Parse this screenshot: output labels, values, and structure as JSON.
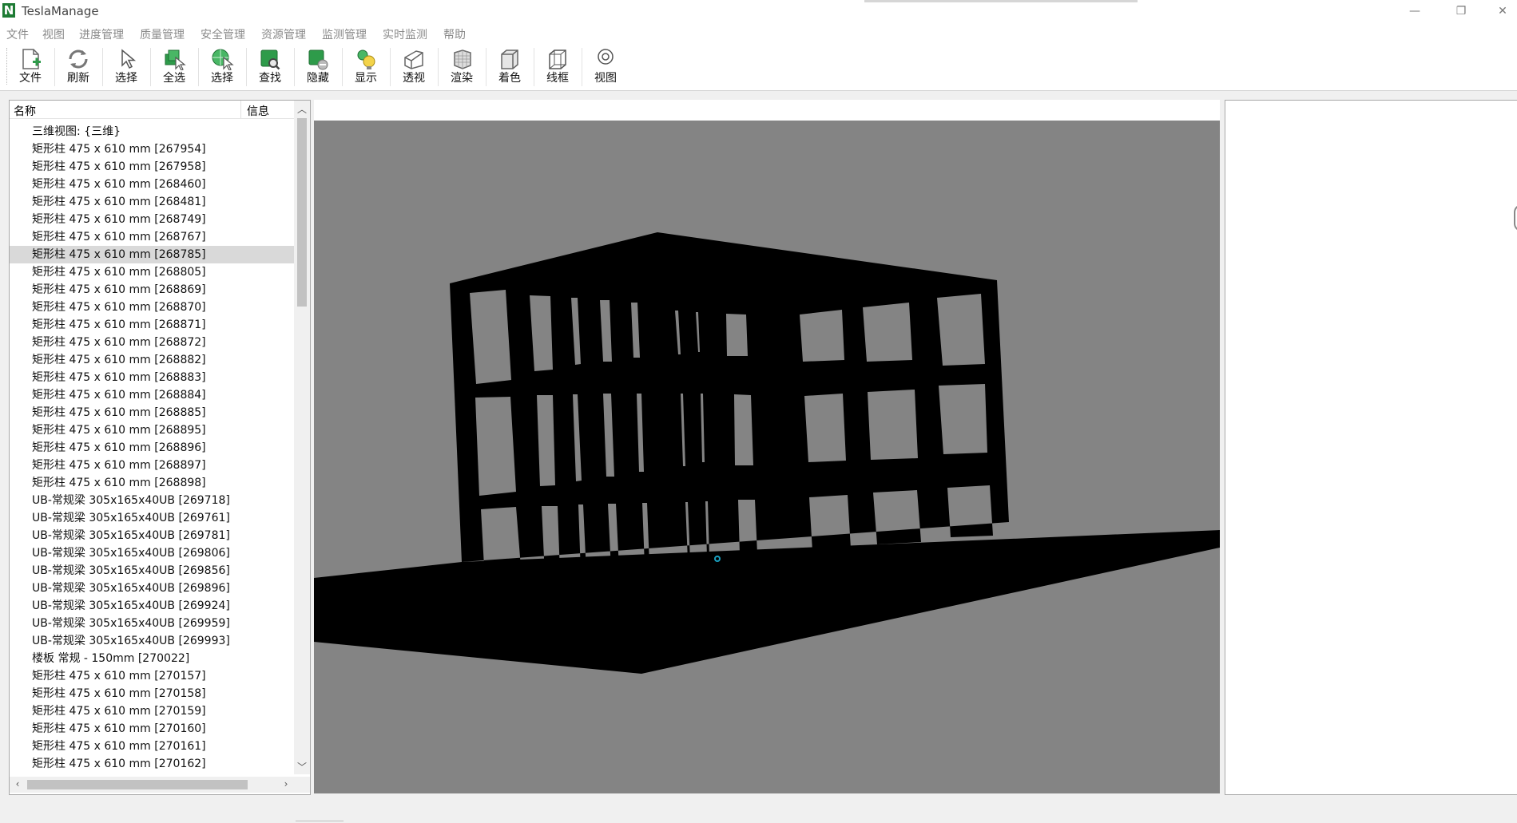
{
  "window": {
    "logo_letter": "N",
    "title": "TeslaManage",
    "minimize_glyph": "—",
    "restore_glyph": "❐",
    "close_glyph": "✕"
  },
  "menu": [
    "文件",
    "视图",
    "进度管理",
    "质量管理",
    "安全管理",
    "资源管理",
    "监测管理",
    "实时监测",
    "帮助"
  ],
  "toolbar": [
    {
      "label": "文件",
      "icon": "new-file-icon"
    },
    {
      "label": "刷新",
      "icon": "refresh-icon"
    },
    {
      "label": "选择",
      "icon": "cursor-icon"
    },
    {
      "label": "全选",
      "icon": "select-all-icon"
    },
    {
      "label": "选择",
      "icon": "select-globe-icon"
    },
    {
      "label": "查找",
      "icon": "find-icon"
    },
    {
      "label": "隐藏",
      "icon": "hide-icon"
    },
    {
      "label": "显示",
      "icon": "show-icon"
    },
    {
      "label": "透视",
      "icon": "perspective-icon"
    },
    {
      "label": "渲染",
      "icon": "render-icon"
    },
    {
      "label": "着色",
      "icon": "shade-icon"
    },
    {
      "label": "线框",
      "icon": "wireframe-icon"
    },
    {
      "label": "视图",
      "icon": "view-icon"
    }
  ],
  "tree": {
    "columns": {
      "name": "名称",
      "info": "信息"
    },
    "selected_index": 7,
    "rows": [
      "三维视图: {三维}",
      "矩形柱 475 x 610 mm [267954]",
      "矩形柱 475 x 610 mm [267958]",
      "矩形柱 475 x 610 mm [268460]",
      "矩形柱 475 x 610 mm [268481]",
      "矩形柱 475 x 610 mm [268749]",
      "矩形柱 475 x 610 mm [268767]",
      "矩形柱 475 x 610 mm [268785]",
      "矩形柱 475 x 610 mm [268805]",
      "矩形柱 475 x 610 mm [268869]",
      "矩形柱 475 x 610 mm [268870]",
      "矩形柱 475 x 610 mm [268871]",
      "矩形柱 475 x 610 mm [268872]",
      "矩形柱 475 x 610 mm [268882]",
      "矩形柱 475 x 610 mm [268883]",
      "矩形柱 475 x 610 mm [268884]",
      "矩形柱 475 x 610 mm [268885]",
      "矩形柱 475 x 610 mm [268895]",
      "矩形柱 475 x 610 mm [268896]",
      "矩形柱 475 x 610 mm [268897]",
      "矩形柱 475 x 610 mm [268898]",
      "UB-常规梁 305x165x40UB [269718]",
      "UB-常规梁 305x165x40UB [269761]",
      "UB-常规梁 305x165x40UB [269781]",
      "UB-常规梁 305x165x40UB [269806]",
      "UB-常规梁 305x165x40UB [269856]",
      "UB-常规梁 305x165x40UB [269896]",
      "UB-常规梁 305x165x40UB [269924]",
      "UB-常规梁 305x165x40UB [269959]",
      "UB-常规梁 305x165x40UB [269993]",
      "楼板 常规 - 150mm [270022]",
      "矩形柱 475 x 610 mm [270157]",
      "矩形柱 475 x 610 mm [270158]",
      "矩形柱 475 x 610 mm [270159]",
      "矩形柱 475 x 610 mm [270160]",
      "矩形柱 475 x 610 mm [270161]",
      "矩形柱 475 x 610 mm [270162]"
    ]
  },
  "colors": {
    "viewport_bg": "#848484",
    "model": "#000000",
    "selection": "#d9d9d9",
    "toolbar_icon_green": "#2e9b4a"
  }
}
